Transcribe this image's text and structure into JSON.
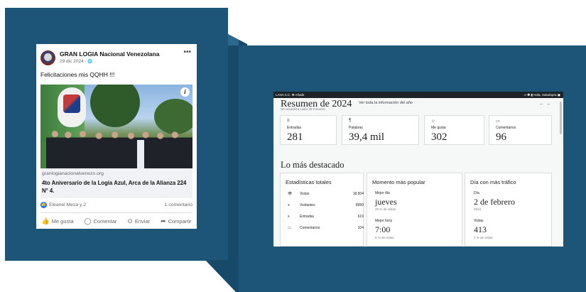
{
  "facebook_post": {
    "page_name": "GRAN LOGIA Nacional Venezolana",
    "date": "29 dic 2024 · ",
    "globe": "🌐",
    "more": "•••",
    "text": "Felicitaciones mis QQHH !!!",
    "info": "i",
    "link": {
      "domain": "granlogianacionalvenezo.org",
      "title": "4to Aniversario de la Logia Azul, Arca de la Alianza 224 N° 4."
    },
    "reactions": "Eleanel Meza y 2",
    "comments": "1 comentario",
    "actions": {
      "like": "Me gusta",
      "comment": "Comentar",
      "send": "Enviar",
      "share": "Compartir"
    }
  },
  "wordpress": {
    "admin_bar": {
      "site": "LANA S.C.   ✚ Añadir",
      "right": "∞   ❷   ▮   Hola, Saludopra  ▣"
    },
    "title": "Resumen de 2024",
    "view_all": "Ver toda la información del año",
    "updated": "Se actualiza cada 30 minutos",
    "nav": "←  →",
    "stats": [
      {
        "icon": "≡",
        "label": "Entradas",
        "value": "281"
      },
      {
        "icon": "¶",
        "label": "Palabras",
        "value": "39,4 mil"
      },
      {
        "icon": "☆",
        "label": "Me gusta",
        "value": "302"
      },
      {
        "icon": "▭",
        "label": "Comentarios",
        "value": "96"
      }
    ],
    "highlights_title": "Lo más destacado",
    "totals": {
      "title": "Estadísticas totales",
      "rows": [
        {
          "icon": "👁",
          "label": "Vistas",
          "value": "18.504"
        },
        {
          "icon": "⩔",
          "label": "Visitantes",
          "value": "8999"
        },
        {
          "icon": "≡",
          "label": "Entradas",
          "value": "619"
        },
        {
          "icon": "▭",
          "label": "Comentarios",
          "value": "104"
        }
      ]
    },
    "popular": {
      "title": "Momento más popular",
      "day_label": "Mejor día",
      "day_value": "jueves",
      "day_sub": "20 % de vistas",
      "hour_label": "Mejor hora",
      "hour_value": "7:00",
      "hour_sub": "8 % de vistas"
    },
    "traffic": {
      "title": "Día con más tráfico",
      "day_label": "Día",
      "day_value": "2 de febrero",
      "day_sub": "2024",
      "views_label": "Vistas",
      "views_value": "413",
      "views_sub": "2 % de vistas"
    }
  }
}
